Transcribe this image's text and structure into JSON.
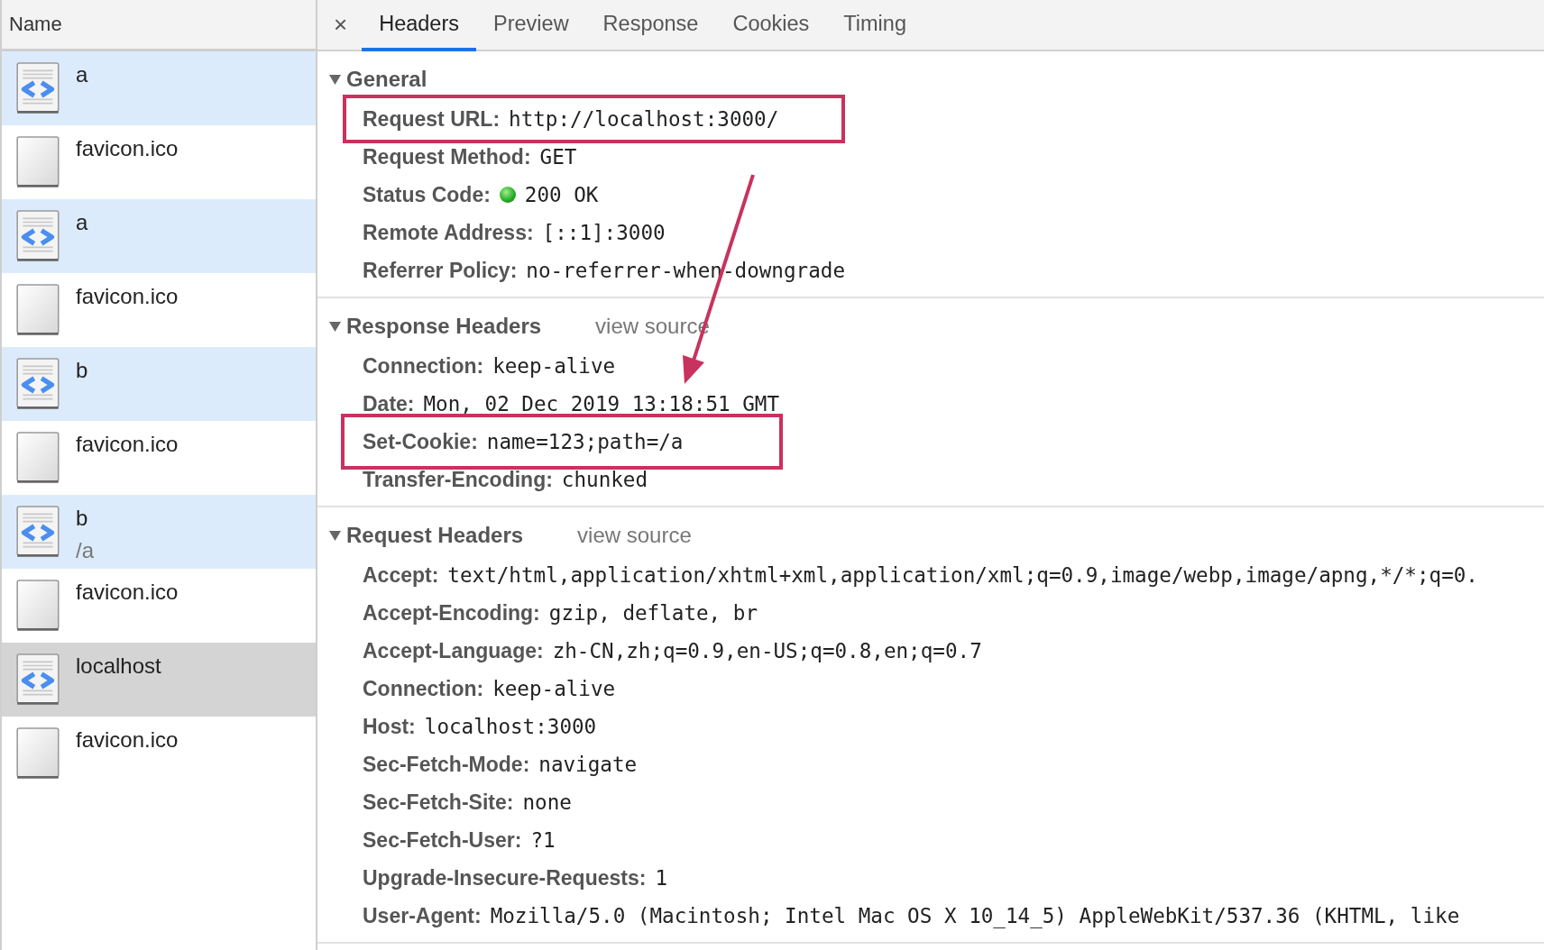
{
  "sidebar": {
    "heading": "Name",
    "items": [
      {
        "kind": "document",
        "name": "a",
        "selected": false
      },
      {
        "kind": "image",
        "name": "favicon.ico",
        "selected": false
      },
      {
        "kind": "document",
        "name": "a",
        "selected": false
      },
      {
        "kind": "image",
        "name": "favicon.ico",
        "selected": false
      },
      {
        "kind": "document",
        "name": "b",
        "selected": false
      },
      {
        "kind": "image",
        "name": "favicon.ico",
        "selected": false
      },
      {
        "kind": "document",
        "name": "b",
        "path": "/a",
        "selected": false
      },
      {
        "kind": "image",
        "name": "favicon.ico",
        "selected": false
      },
      {
        "kind": "document",
        "name": "localhost",
        "selected": true
      },
      {
        "kind": "image",
        "name": "favicon.ico",
        "selected": false
      }
    ]
  },
  "close": "×",
  "tabs": [
    {
      "label": "Headers",
      "selected": true
    },
    {
      "label": "Preview",
      "selected": false
    },
    {
      "label": "Response",
      "selected": false
    },
    {
      "label": "Cookies",
      "selected": false
    },
    {
      "label": "Timing",
      "selected": false
    }
  ],
  "sections": [
    {
      "title": "General",
      "expanded": true,
      "rows": [
        {
          "kind": "plain",
          "name": "Request URL:",
          "value": "http://localhost:3000/",
          "highlighted": true
        },
        {
          "kind": "plain",
          "name": "Request Method:",
          "value": "GET",
          "highlighted": false
        },
        {
          "kind": "status",
          "name": "Status Code:",
          "value": "200 OK",
          "highlighted": false
        },
        {
          "kind": "plain",
          "name": "Remote Address:",
          "value": "[::1]:3000",
          "highlighted": false
        },
        {
          "kind": "plain",
          "name": "Referrer Policy:",
          "value": "no-referrer-when-downgrade",
          "highlighted": false
        }
      ]
    },
    {
      "title": "Response Headers",
      "link": "view source",
      "expanded": true,
      "rows": [
        {
          "kind": "plain",
          "name": "Connection:",
          "value": "keep-alive",
          "highlighted": false
        },
        {
          "kind": "plain",
          "name": "Date:",
          "value": "Mon, 02 Dec 2019 13:18:51 GMT",
          "highlighted": false
        },
        {
          "kind": "plain",
          "name": "Set-Cookie:",
          "value": "name=123;path=/a",
          "highlighted": true
        },
        {
          "kind": "plain",
          "name": "Transfer-Encoding:",
          "value": "chunked",
          "highlighted": false
        }
      ]
    },
    {
      "title": "Request Headers",
      "link": "view source",
      "expanded": true,
      "rows": [
        {
          "kind": "plain",
          "name": "Accept:",
          "value": "text/html,application/xhtml+xml,application/xml;q=0.9,image/webp,image/apng,*/*;q=0.",
          "highlighted": false
        },
        {
          "kind": "plain",
          "name": "Accept-Encoding:",
          "value": "gzip, deflate, br",
          "highlighted": false
        },
        {
          "kind": "plain",
          "name": "Accept-Language:",
          "value": "zh-CN,zh;q=0.9,en-US;q=0.8,en;q=0.7",
          "highlighted": false
        },
        {
          "kind": "plain",
          "name": "Connection:",
          "value": "keep-alive",
          "highlighted": false
        },
        {
          "kind": "plain",
          "name": "Host:",
          "value": "localhost:3000",
          "highlighted": false
        },
        {
          "kind": "plain",
          "name": "Sec-Fetch-Mode:",
          "value": "navigate",
          "highlighted": false
        },
        {
          "kind": "plain",
          "name": "Sec-Fetch-Site:",
          "value": "none",
          "highlighted": false
        },
        {
          "kind": "plain",
          "name": "Sec-Fetch-User:",
          "value": "?1",
          "highlighted": false
        },
        {
          "kind": "plain",
          "name": "Upgrade-Insecure-Requests:",
          "value": "1",
          "highlighted": false
        },
        {
          "kind": "plain",
          "name": "User-Agent:",
          "value": "Mozilla/5.0 (Macintosh; Intel Mac OS X 10_14_5) AppleWebKit/537.36 (KHTML, like",
          "highlighted": false
        }
      ]
    }
  ]
}
